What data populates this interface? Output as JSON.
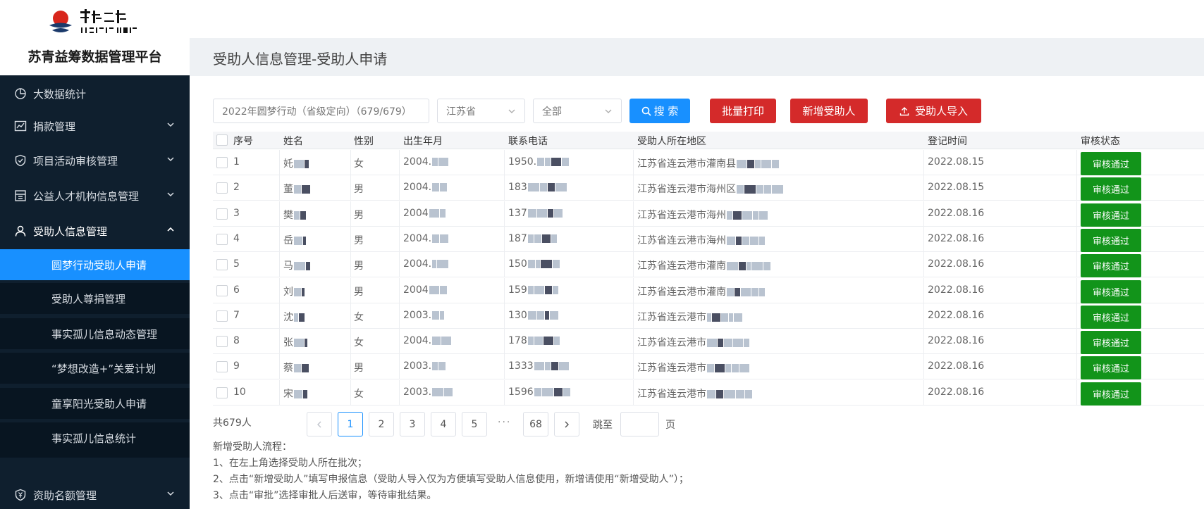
{
  "sidebar": {
    "logo_text": "希望工程",
    "logo_subtext": "PROJECT HOPE",
    "title": "苏青益筹数据管理平台",
    "menu": [
      {
        "label": "大数据统计",
        "icon": "pie-chart-icon"
      },
      {
        "label": "捐款管理",
        "icon": "line-chart-icon"
      },
      {
        "label": "项目活动审核管理",
        "icon": "shield-check-icon"
      },
      {
        "label": "公益人才机构信息管理",
        "icon": "building-icon"
      },
      {
        "label": "受助人信息管理",
        "icon": "user-icon"
      }
    ],
    "submenu": [
      {
        "label": "圆梦行动受助人申请"
      },
      {
        "label": "受助人尊捐管理"
      },
      {
        "label": "事实孤儿信息动态管理"
      },
      {
        "label": "“梦想改造+”关爱计划"
      },
      {
        "label": "童享阳光受助人申请"
      },
      {
        "label": "事实孤儿信息统计"
      }
    ],
    "bottom_menu": {
      "label": "资助名额管理",
      "icon": "shield-yen-icon"
    }
  },
  "header": {
    "page_title": "受助人信息管理-受助人申请"
  },
  "toolbar": {
    "batch_select": "2022年圆梦行动（省级定向）（679/679）",
    "province_select": "江苏省",
    "range_select": "全部",
    "search_label": "搜 索",
    "print_label": "批量打印",
    "add_label": "新增受助人",
    "import_label": "受助人导入"
  },
  "table": {
    "headers": [
      "序号",
      "姓名",
      "性别",
      "出生年月",
      "联系电话",
      "受助人所在地区",
      "登记时间",
      "审核状态"
    ],
    "rows": [
      {
        "no": "1",
        "name": "奼",
        "gender": "女",
        "birth": "2004.",
        "phone": "1950.",
        "region": "江苏省连云港市灌南县",
        "time": "2022.08.15",
        "status": "审核通过"
      },
      {
        "no": "2",
        "name": "董",
        "gender": "男",
        "birth": "2004.",
        "phone": "183",
        "region": "江苏省连云港市海州区",
        "time": "2022.08.15",
        "status": "审核通过"
      },
      {
        "no": "3",
        "name": "樊",
        "gender": "男",
        "birth": "2004",
        "phone": "137",
        "region": "江苏省连云港市海州",
        "time": "2022.08.16",
        "status": "审核通过"
      },
      {
        "no": "4",
        "name": "岳",
        "gender": "男",
        "birth": "2004.",
        "phone": "187",
        "region": "江苏省连云港市海州",
        "time": "2022.08.16",
        "status": "审核通过"
      },
      {
        "no": "5",
        "name": "马",
        "gender": "男",
        "birth": "2004.",
        "phone": "150",
        "region": "江苏省连云港市灌南",
        "time": "2022.08.16",
        "status": "审核通过"
      },
      {
        "no": "6",
        "name": "刘",
        "gender": "男",
        "birth": "2004",
        "phone": "159",
        "region": "江苏省连云港市灌南",
        "time": "2022.08.16",
        "status": "审核通过"
      },
      {
        "no": "7",
        "name": "沈",
        "gender": "女",
        "birth": "2003.",
        "phone": "130",
        "region": "江苏省连云港市",
        "time": "2022.08.16",
        "status": "审核通过"
      },
      {
        "no": "8",
        "name": "张",
        "gender": "女",
        "birth": "2004.",
        "phone": "178",
        "region": "江苏省连云港市",
        "time": "2022.08.16",
        "status": "审核通过"
      },
      {
        "no": "9",
        "name": "蔡",
        "gender": "男",
        "birth": "2003.",
        "phone": "1333",
        "region": "江苏省连云港市",
        "time": "2022.08.16",
        "status": "审核通过"
      },
      {
        "no": "10",
        "name": "宋",
        "gender": "女",
        "birth": "2003.",
        "phone": "1596",
        "region": "江苏省连云港市",
        "time": "2022.08.16",
        "status": "审核通过"
      }
    ]
  },
  "pagination": {
    "total": "共679人",
    "pages": [
      "1",
      "2",
      "3",
      "4",
      "5"
    ],
    "ellipsis": "···",
    "last_page": "68",
    "current": "1",
    "jump_prefix": "跳至",
    "jump_suffix": "页"
  },
  "notes": [
    "新增受助人流程：",
    "1、在左上角选择受助人所在批次；",
    "2、点击“新增受助人”填写申报信息（受助人导入仅为方便填写受助人信息使用，新增请使用“新增受助人”）；",
    "3、点击“审批”选择审批人后送审，等待审批结果。"
  ],
  "colors": {
    "primary": "#1890ff",
    "danger": "#d42a2a",
    "success": "#12941a",
    "sidebar": "#0f1f2e"
  }
}
